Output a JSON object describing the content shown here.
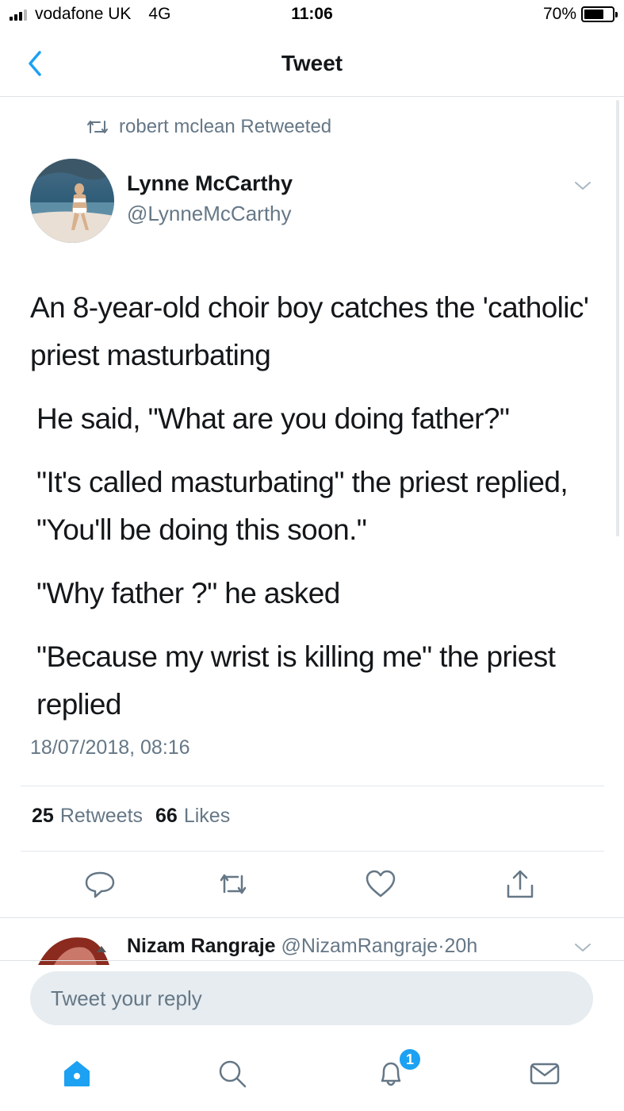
{
  "status_bar": {
    "carrier": "vodafone UK",
    "network": "4G",
    "time": "11:06",
    "battery": "70%",
    "battery_level": 0.7
  },
  "nav": {
    "title": "Tweet",
    "back_icon": "chevron-left-icon"
  },
  "retweet_header": {
    "text": "robert mclean Retweeted",
    "icon": "retweet-icon"
  },
  "author": {
    "name": "Lynne McCarthy",
    "handle": "@LynneMcCarthy"
  },
  "tweet": {
    "paragraphs": [
      "An 8-year-old choir boy catches the 'catholic' priest masturbating",
      "He said, \"What are you doing father?\"",
      "\"It's called masturbating\" the priest replied, \"You'll be doing this soon.\"",
      "\"Why father ?\" he asked",
      "\"Because my wrist is killing me\" the priest replied"
    ],
    "timestamp": "18/07/2018, 08:16"
  },
  "stats": {
    "retweets_count": "25",
    "retweets_label": "Retweets",
    "likes_count": "66",
    "likes_label": "Likes"
  },
  "actions": [
    "reply-icon",
    "retweet-icon",
    "like-icon",
    "share-icon"
  ],
  "reply_preview": {
    "name": "Nizam Rangraje",
    "handle": "@NizamRangraje",
    "separator": "·",
    "time": "20h"
  },
  "reply_input": {
    "placeholder": "Tweet your reply"
  },
  "tab_bar": {
    "items": [
      "home-icon",
      "search-icon",
      "notifications-icon",
      "messages-icon"
    ],
    "notification_badge": "1"
  },
  "colors": {
    "accent": "#1da1f2",
    "secondary_text": "#657786",
    "primary_text": "#14171a"
  }
}
